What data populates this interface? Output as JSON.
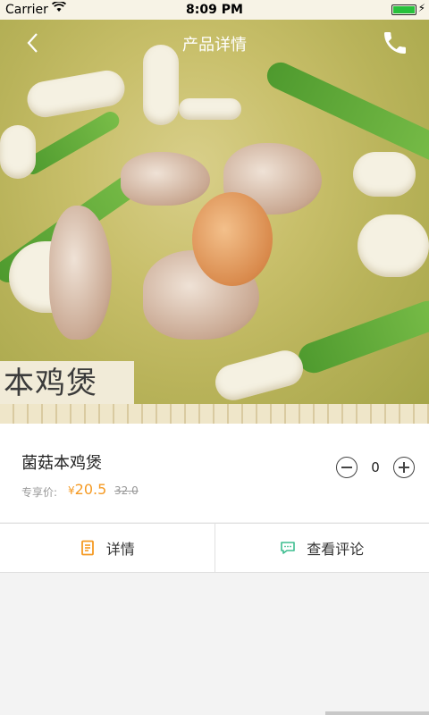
{
  "status_bar": {
    "carrier": "Carrier",
    "time": "8:09 PM",
    "battery_level": 1.0
  },
  "nav": {
    "title": "产品详情",
    "back_icon": "chevron-left-icon",
    "phone_icon": "phone-icon"
  },
  "hero": {
    "image": "mushroom-chicken-stew-photo",
    "label_text": "本鸡煲"
  },
  "product": {
    "name": "菌菇本鸡煲",
    "price_label": "专享价:",
    "currency": "¥",
    "price": "20.5",
    "original_price": "32.0",
    "quantity": "0",
    "accent_color": "#f59a23"
  },
  "tabs": [
    {
      "label": "详情",
      "icon": "document-icon",
      "color": "#f59a23"
    },
    {
      "label": "查看评论",
      "icon": "comment-icon",
      "color": "#3dbd8f"
    }
  ]
}
